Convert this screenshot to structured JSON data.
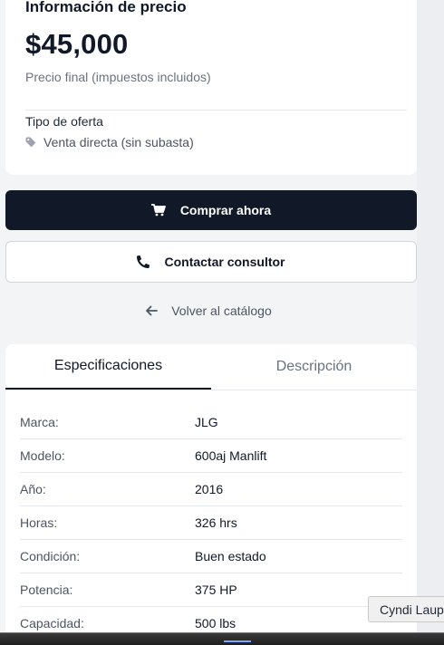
{
  "price": {
    "title": "Información de precio",
    "amount": "$45,000",
    "note": "Precio final (impuestos incluidos)",
    "offer_label": "Tipo de oferta",
    "offer_type": "Venta directa (sin subasta)"
  },
  "actions": {
    "buy_label": "Comprar ahora",
    "contact_label": "Contactar consultor",
    "back_label": "Volver al catálogo"
  },
  "tabs": {
    "specs": "Especificaciones",
    "description": "Descripción",
    "active": "specs"
  },
  "specs": [
    {
      "key": "Marca:",
      "value": "JLG"
    },
    {
      "key": "Modelo:",
      "value": "600aj Manlift"
    },
    {
      "key": "Año:",
      "value": "2016"
    },
    {
      "key": "Horas:",
      "value": "326 hrs"
    },
    {
      "key": "Condición:",
      "value": "Buen estado"
    },
    {
      "key": "Potencia:",
      "value": "375 HP"
    },
    {
      "key": "Capacidad:",
      "value": "500 lbs"
    }
  ],
  "tooltip": {
    "text": "Cyndi Laup"
  },
  "icons": {
    "offer": "tag-icon",
    "buy": "cart-icon",
    "contact": "phone-icon",
    "back": "arrow-left-icon"
  },
  "colors": {
    "primary": "#111827",
    "muted": "#6b7280",
    "background": "#f3f4f6",
    "card": "#ffffff",
    "border": "#e5e7eb"
  }
}
